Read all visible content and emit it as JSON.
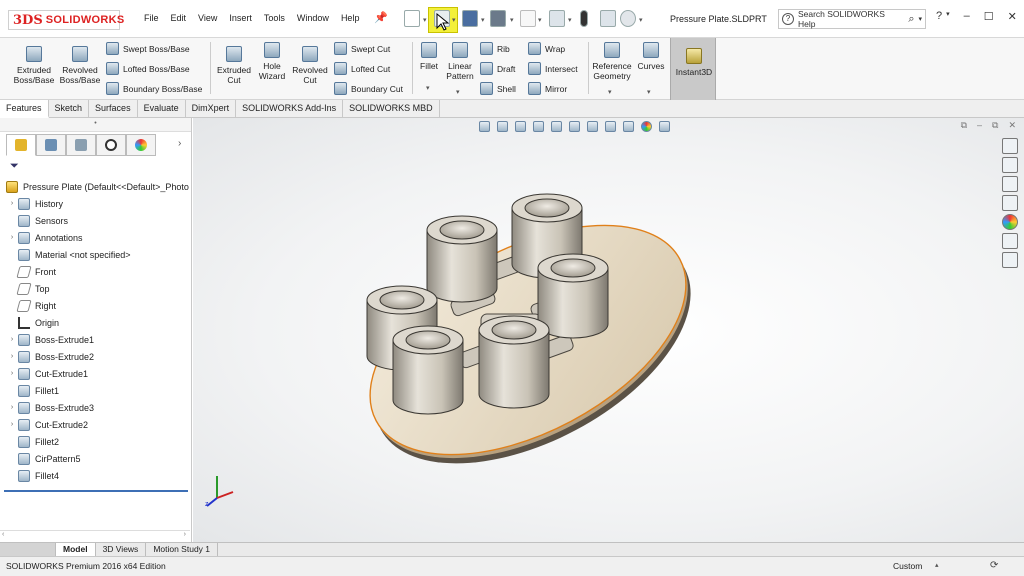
{
  "app": {
    "logo_mark": "3DS",
    "logo_text": "SOLIDWORKS",
    "document_title": "Pressure Plate.SLDPRT"
  },
  "menu": [
    "File",
    "Edit",
    "View",
    "Insert",
    "Tools",
    "Window",
    "Help"
  ],
  "help_search": {
    "placeholder": "Search SOLIDWORKS Help"
  },
  "ribbon": {
    "extruded_boss": "Extruded Boss/Base",
    "revolved_boss": "Revolved Boss/Base",
    "swept_boss": "Swept Boss/Base",
    "lofted_boss": "Lofted Boss/Base",
    "boundary_boss": "Boundary Boss/Base",
    "extruded_cut": "Extruded Cut",
    "hole_wizard": "Hole Wizard",
    "revolved_cut": "Revolved Cut",
    "swept_cut": "Swept Cut",
    "lofted_cut": "Lofted Cut",
    "boundary_cut": "Boundary Cut",
    "fillet": "Fillet",
    "linear_pattern": "Linear Pattern",
    "rib": "Rib",
    "draft": "Draft",
    "shell": "Shell",
    "wrap": "Wrap",
    "intersect": "Intersect",
    "mirror": "Mirror",
    "reference_geometry": "Reference Geometry",
    "curves": "Curves",
    "instant3d": "Instant3D"
  },
  "command_tabs": [
    "Features",
    "Sketch",
    "Surfaces",
    "Evaluate",
    "DimXpert",
    "SOLIDWORKS Add-Ins",
    "SOLIDWORKS MBD"
  ],
  "tree": {
    "root": "Pressure Plate  (Default<<Default>_Photo",
    "items": [
      "History",
      "Sensors",
      "Annotations",
      "Material <not specified>",
      "Front",
      "Top",
      "Right",
      "Origin",
      "Boss-Extrude1",
      "Boss-Extrude2",
      "Cut-Extrude1",
      "Fillet1",
      "Boss-Extrude3",
      "Cut-Extrude2",
      "Fillet2",
      "CirPattern5",
      "Fillet4"
    ]
  },
  "bottom_tabs": [
    "Model",
    "3D Views",
    "Motion Study 1"
  ],
  "status": {
    "text": "SOLIDWORKS Premium 2016 x64 Edition",
    "units": "Custom"
  },
  "colors": {
    "highlight": "#f3f03a",
    "logo_red": "#dd2222",
    "selection_orange": "#e0801a",
    "part_gray": "#bdb8ad",
    "plate_tan": "#e8dcc6"
  },
  "icons": [
    "new-document-icon",
    "open-icon",
    "save-icon",
    "print-icon",
    "undo-icon",
    "select-icon",
    "rebuild-icon",
    "file-properties-icon",
    "options-icon"
  ]
}
